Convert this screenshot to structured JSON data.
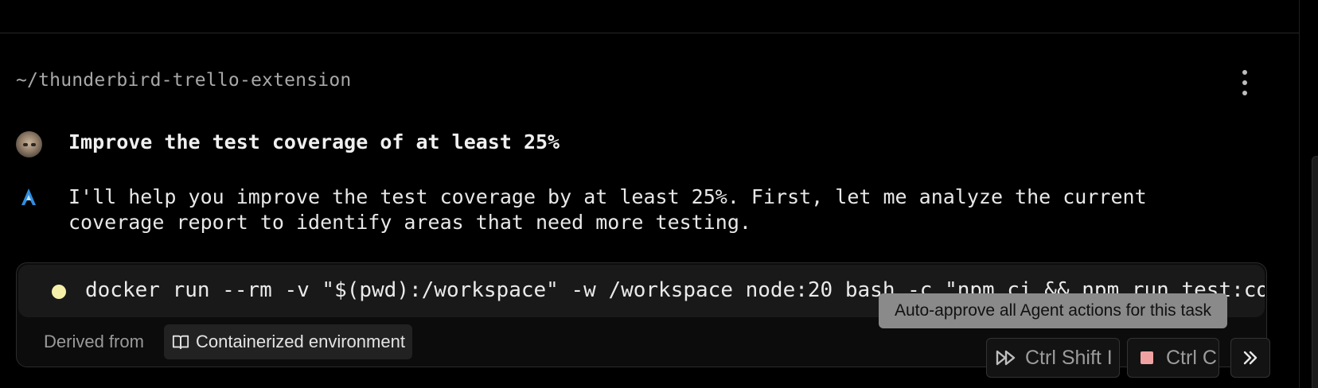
{
  "header": {
    "path": "~/thunderbird-trello-extension",
    "menu_icon": "kebab-menu-icon"
  },
  "conversation": {
    "user_message": "Improve the test coverage of at least 25%",
    "agent_message_line1": "I'll help you improve the test coverage by at least 25%. First, let me analyze the current",
    "agent_message_line2": "coverage report to identify areas that need more testing."
  },
  "command": {
    "status_color": "#f6efaa",
    "text": "docker run --rm -v \"$(pwd):/workspace\" -w /workspace node:20 bash -c \"npm ci && npm run test:coverage\"",
    "derived_label": "Derived from",
    "source_label": "Containerized environment",
    "source_icon": "book-icon"
  },
  "tooltip": {
    "text": "Auto-approve all Agent actions for this task"
  },
  "actions": {
    "auto_approve_label": "Ctrl Shift I",
    "auto_approve_icon": "fast-forward-icon",
    "stop_label": "Ctrl C",
    "stop_icon": "stop-icon",
    "stop_color": "#f0a2a2",
    "more_icon": "double-chevron-right-icon"
  }
}
